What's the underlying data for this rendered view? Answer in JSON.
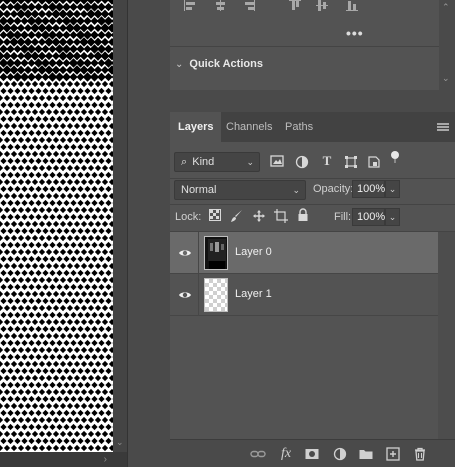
{
  "top_panel": {
    "more_label": "•••",
    "quick_actions": {
      "title": "Quick Actions",
      "chevron": "chevron-down-icon"
    }
  },
  "layers_panel": {
    "tabs": [
      {
        "label": "Layers",
        "active": true
      },
      {
        "label": "Channels",
        "active": false
      },
      {
        "label": "Paths",
        "active": false
      }
    ],
    "filter": {
      "label": "Kind",
      "icons": [
        "image-filter-icon",
        "adjustment-filter-icon",
        "type-filter-icon",
        "shape-filter-icon",
        "smart-object-filter-icon",
        "filter-toggle-icon"
      ]
    },
    "blend_mode": "Normal",
    "opacity": {
      "label": "Opacity:",
      "value": "100%"
    },
    "lock": {
      "label": "Lock:",
      "icons": [
        "lock-transparent-icon",
        "lock-paint-icon",
        "lock-move-icon",
        "lock-artboard-icon",
        "lock-all-icon"
      ]
    },
    "fill": {
      "label": "Fill:",
      "value": "100%"
    },
    "layers": [
      {
        "name": "Layer 0",
        "visible": true,
        "selected": true,
        "thumb": "dark"
      },
      {
        "name": "Layer 1",
        "visible": true,
        "selected": false,
        "thumb": "transparent"
      }
    ],
    "bottom_icons": [
      "link-icon",
      "fx-icon",
      "mask-icon",
      "adjustment-icon",
      "folder-icon",
      "new-layer-icon",
      "trash-icon"
    ],
    "fx_label": "fx"
  },
  "colors": {
    "panel": "#535353",
    "selected_row": "#6a6a6a",
    "tab_bar": "#424242"
  }
}
